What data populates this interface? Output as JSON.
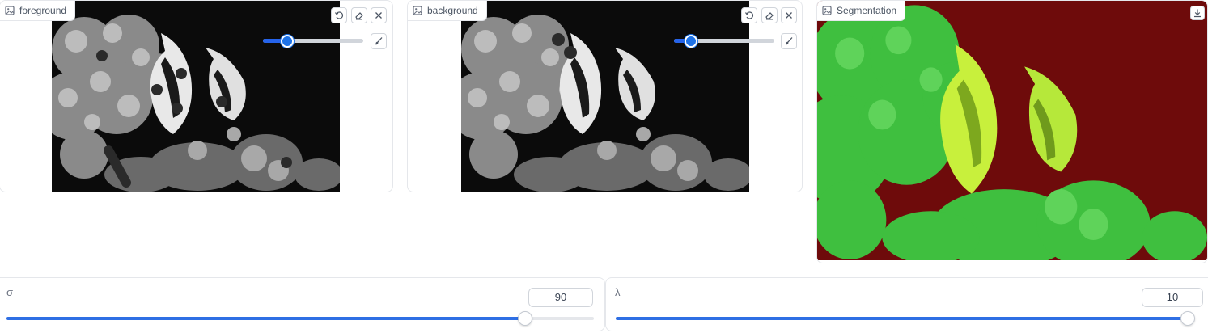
{
  "foreground": {
    "label": "foreground",
    "icon": "image-icon",
    "brush_size": 0.2
  },
  "background": {
    "label": "background",
    "icon": "image-icon",
    "brush_size": 0.12
  },
  "segmentation": {
    "label": "Segmentation",
    "icon": "image-icon"
  },
  "toolbar_icons": [
    "undo-icon",
    "eraser-icon",
    "close-icon",
    "brush-icon"
  ],
  "params": {
    "sigma": {
      "label": "σ",
      "value": "90",
      "fraction": 0.893
    },
    "lambda": {
      "label": "λ",
      "value": "10",
      "fraction": 1.0
    }
  },
  "colors": {
    "accent": "#2f6fe4",
    "seg_background": "#6e0b0b",
    "seg_foreground": "#3fbf3f",
    "seg_fish": "#c8f03c"
  }
}
